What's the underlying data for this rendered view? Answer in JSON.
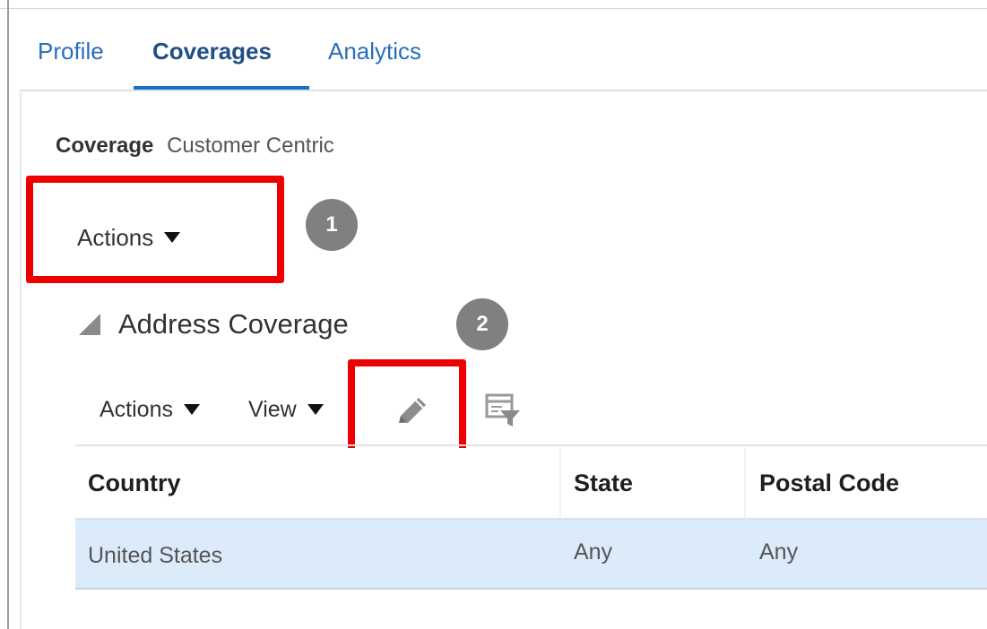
{
  "tabs": [
    {
      "label": "Profile"
    },
    {
      "label": "Coverages",
      "selected": true
    },
    {
      "label": "Analytics"
    }
  ],
  "coverage": {
    "label": "Coverage",
    "value": "Customer Centric"
  },
  "actions_menu": {
    "label": "Actions"
  },
  "steps": [
    "1",
    "2"
  ],
  "section": {
    "title": "Address Coverage"
  },
  "table_toolbar": {
    "actions_label": "Actions",
    "view_label": "View",
    "icons": [
      "pencil-edit-icon",
      "query-by-example-filter-icon"
    ]
  },
  "table": {
    "columns": [
      "Country",
      "State",
      "Postal Code"
    ],
    "rows": [
      {
        "cells": [
          "United States",
          "Any",
          "Any"
        ],
        "selected": true
      }
    ]
  },
  "colors": {
    "accent": "#1b6fc2",
    "tab_text": "#2a6ebb",
    "highlight_box": "#ee0000",
    "step_badge": "#808080",
    "selected_row": "#dcebfa"
  }
}
